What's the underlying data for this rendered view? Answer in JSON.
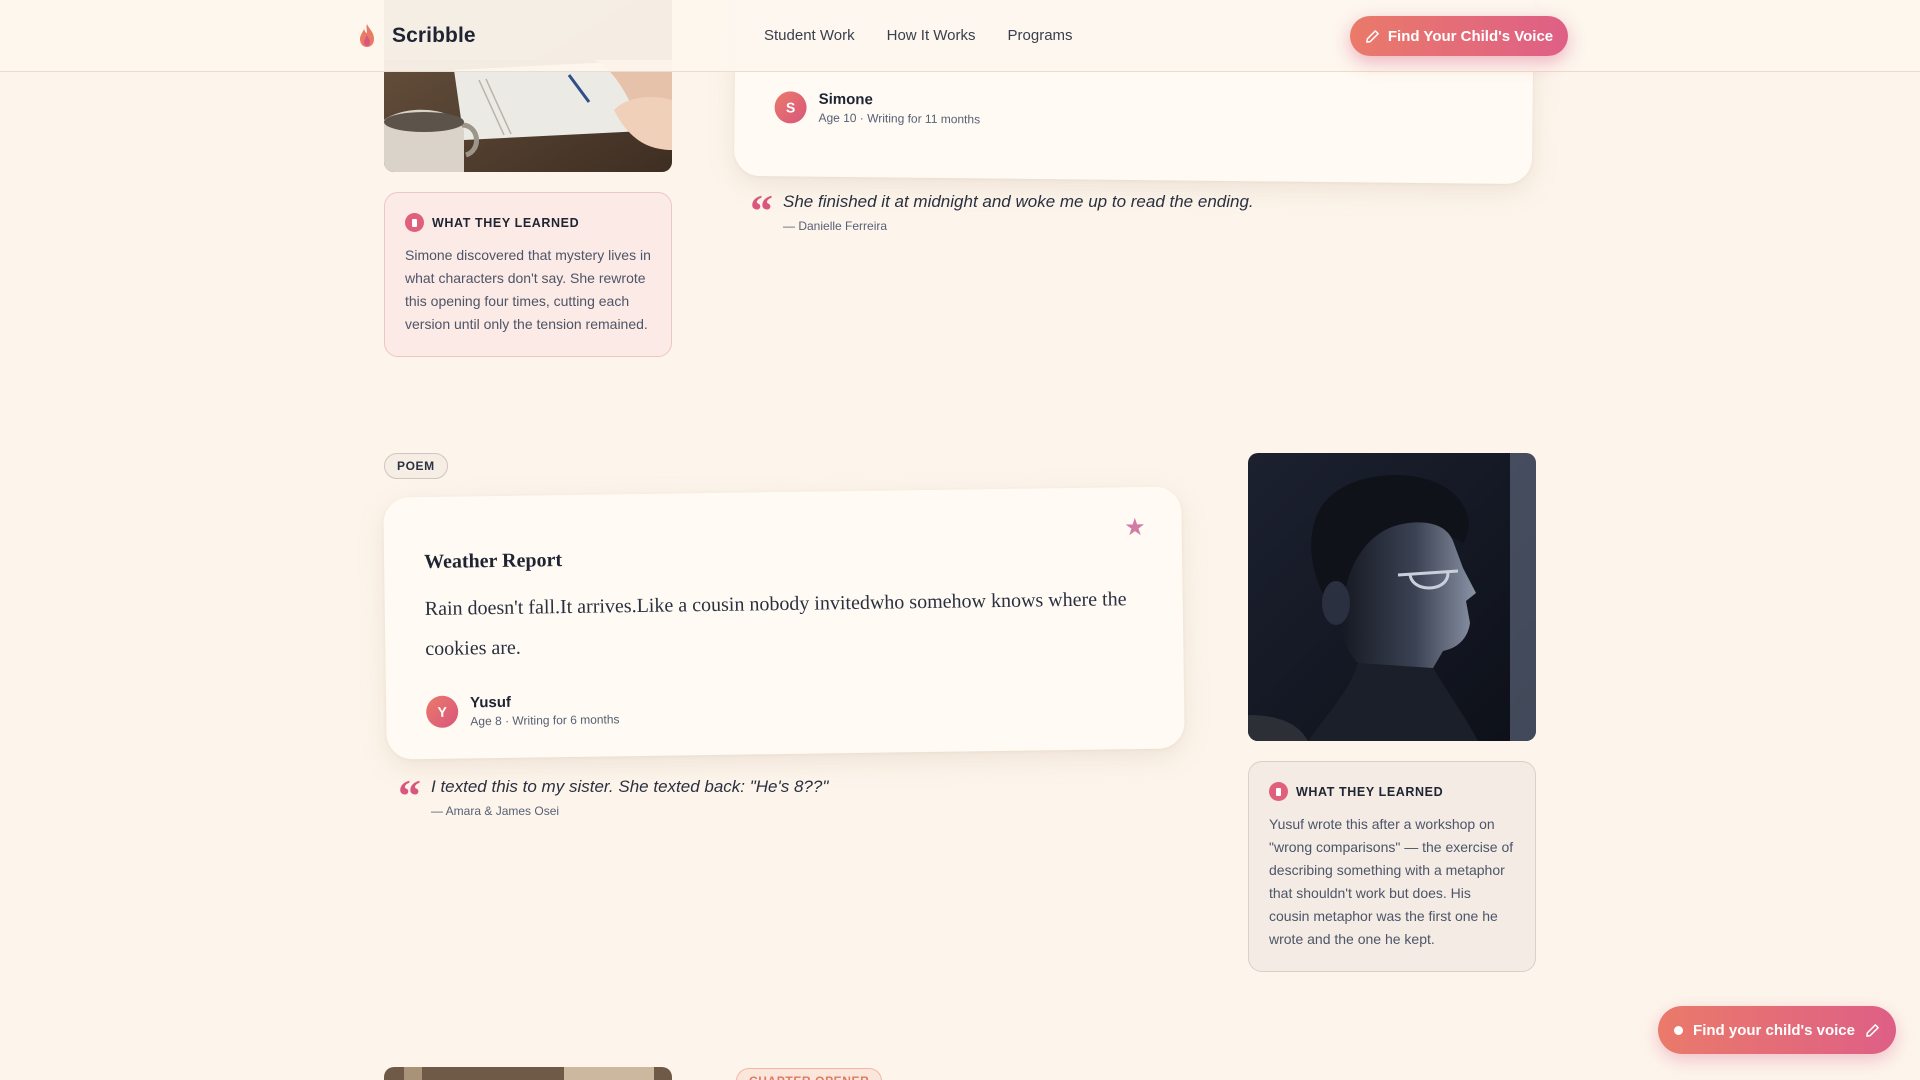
{
  "header": {
    "brand": "Scribble",
    "nav": [
      "Student Work",
      "How It Works",
      "Programs"
    ],
    "cta_label": "Find Your Child's Voice"
  },
  "story_top": {
    "author_initial": "S",
    "author_name": "Simone",
    "author_meta": "Age 10 · Writing for 11 months",
    "learned_title": "WHAT THEY LEARNED",
    "learned_body": "Simone discovered that mystery lives in what characters don't say. She rewrote this opening four times, cutting each version until only the tension remained.",
    "quote": "She finished it at midnight and woke me up to read the ending.",
    "quote_attr": "— Danielle Ferreira"
  },
  "story_poem": {
    "tag": "POEM",
    "title": "Weather Report",
    "body": "Rain doesn't fall.It arrives.Like a cousin nobody invitedwho somehow knows where the cookies are.",
    "author_initial": "Y",
    "author_name": "Yusuf",
    "author_meta": "Age 8 · Writing for 6 months",
    "learned_title": "WHAT THEY LEARNED",
    "learned_body": "Yusuf wrote this after a workshop on \"wrong comparisons\" — the exercise of describing something with a metaphor that shouldn't work but does. His cousin metaphor was the first one he wrote and the one he kept.",
    "quote": "I texted this to my sister. She texted back: \"He's 8??\"",
    "quote_attr": "— Amara & James Osei"
  },
  "story_next": {
    "tag": "CHAPTER OPENER"
  },
  "floating_cta": {
    "label": "Find your child's voice"
  },
  "colors": {
    "background": "#fdf5ec",
    "accent_start": "#ea7a6a",
    "accent_end": "#de5f86",
    "text_dark": "#1f2433"
  },
  "icons": {
    "logo": "flame-icon",
    "cta": "pencil-icon",
    "star": "star-icon",
    "learned": "info-icon",
    "quote": "quote-icon"
  }
}
